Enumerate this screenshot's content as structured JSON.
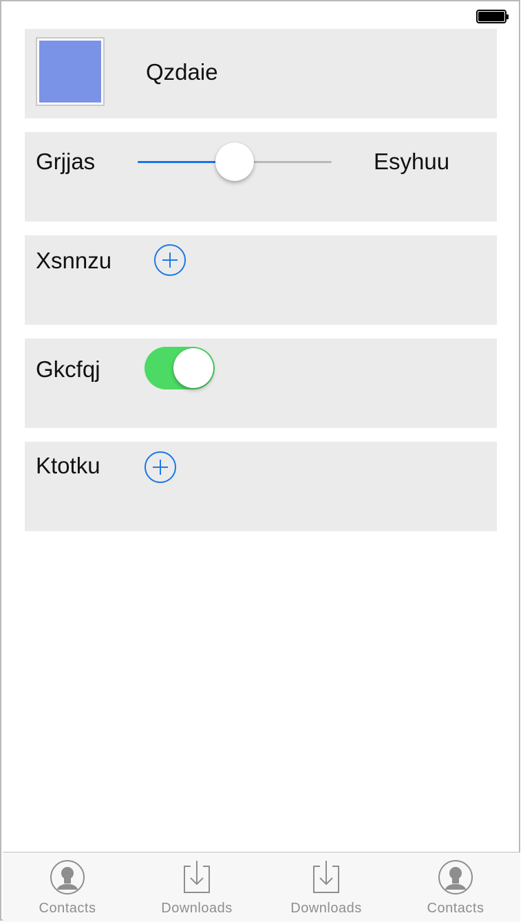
{
  "rows": [
    {
      "label": "Qzdaie",
      "swatch_color": "#7a93e6"
    },
    {
      "label": "Grjjas",
      "right_label": "Esyhuu",
      "slider_value": 0.5
    },
    {
      "label": "Xsnnzu",
      "icon": "plus-circle-icon"
    },
    {
      "label": "Gkcfqj",
      "toggle_on": true
    },
    {
      "label": "Ktotku",
      "icon": "plus-circle-icon"
    }
  ],
  "tabs": [
    {
      "label": "Contacts",
      "icon": "contact-icon"
    },
    {
      "label": "Downloads",
      "icon": "download-icon"
    },
    {
      "label": "Downloads",
      "icon": "download-icon"
    },
    {
      "label": "Contacts",
      "icon": "contact-icon"
    }
  ],
  "colors": {
    "accent": "#1a7ae8",
    "toggle_on": "#4cd964",
    "card_bg": "#ebebeb",
    "tab_inactive": "#8e8e8e"
  }
}
